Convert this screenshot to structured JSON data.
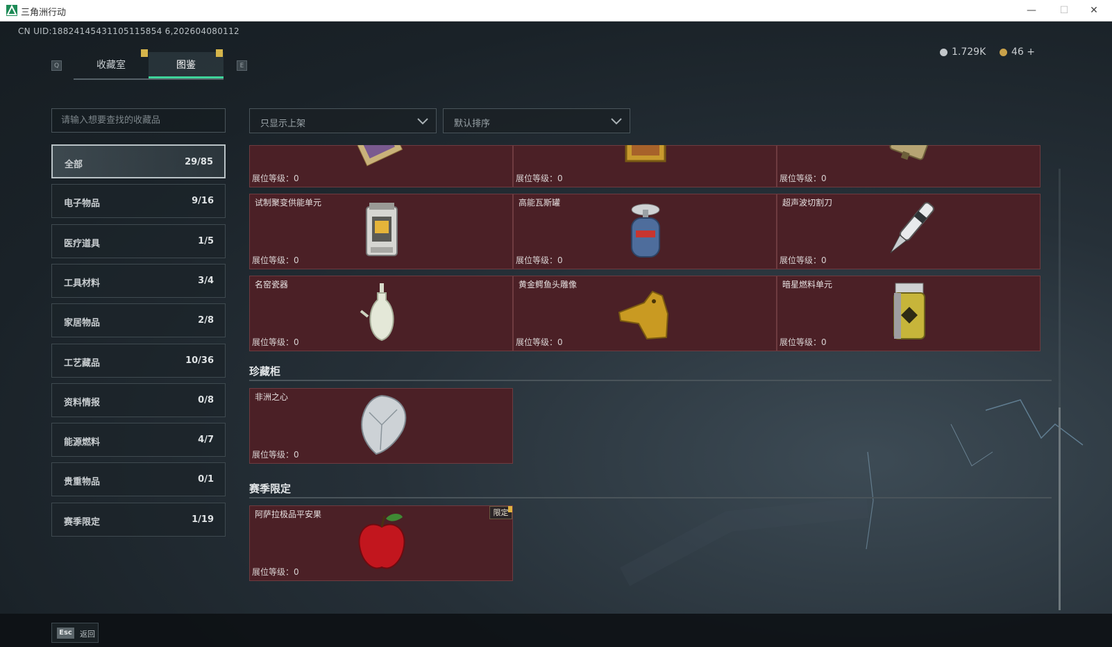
{
  "window": {
    "title": "三角洲行动",
    "minimize": "—",
    "maximize": "☐",
    "close": "✕"
  },
  "uid": "CN UID:18824145431105115854 6,202604080112",
  "tabs": {
    "key_left": "Q",
    "key_right": "E",
    "items": [
      {
        "label": "收藏室"
      },
      {
        "label": "图鉴"
      }
    ],
    "active": "图鉴"
  },
  "currency": [
    {
      "value": "1.729K",
      "color": "#c2c7ca"
    },
    {
      "value": "46 +",
      "color": "#c9a24a"
    }
  ],
  "search": {
    "placeholder": "请输入想要查找的收藏品"
  },
  "categories": [
    {
      "label": "全部",
      "count": "29/85",
      "active": true
    },
    {
      "label": "电子物品",
      "count": "9/16"
    },
    {
      "label": "医疗道具",
      "count": "1/5"
    },
    {
      "label": "工具材料",
      "count": "3/4"
    },
    {
      "label": "家居物品",
      "count": "2/8"
    },
    {
      "label": "工艺藏品",
      "count": "10/36"
    },
    {
      "label": "资料情报",
      "count": "0/8"
    },
    {
      "label": "能源燃料",
      "count": "4/7"
    },
    {
      "label": "贵重物品",
      "count": "0/1"
    },
    {
      "label": "赛季限定",
      "count": "1/19"
    }
  ],
  "filters": {
    "display": "只显示上架",
    "sort": "默认排序"
  },
  "level_label": "展位等级：",
  "rows": [
    [
      {
        "name": "",
        "level": "0",
        "icon": "card-artifact-icon"
      },
      {
        "name": "",
        "level": "0",
        "icon": "framed-painting-icon"
      },
      {
        "name": "",
        "level": "0",
        "icon": "circuit-device-icon"
      }
    ],
    [
      {
        "name": "试制聚变供能单元",
        "level": "0",
        "icon": "fusion-unit-icon"
      },
      {
        "name": "高能瓦斯罐",
        "level": "0",
        "icon": "gas-canister-icon"
      },
      {
        "name": "超声波切割刀",
        "level": "0",
        "icon": "ultrasonic-knife-icon"
      }
    ],
    [
      {
        "name": "名窑瓷器",
        "level": "0",
        "icon": "porcelain-vase-icon"
      },
      {
        "name": "黄金鳄鱼头雕像",
        "level": "0",
        "icon": "gold-crocodile-icon"
      },
      {
        "name": "暗星燃料单元",
        "level": "0",
        "icon": "fuel-cell-icon"
      }
    ]
  ],
  "sections": [
    {
      "title": "珍藏柜",
      "items": [
        {
          "name": "非洲之心",
          "level": "0",
          "icon": "diamond-icon"
        }
      ]
    },
    {
      "title": "赛季限定",
      "items": [
        {
          "name": "阿萨拉极品平安果",
          "level": "0",
          "icon": "apple-icon",
          "badge": "限定"
        }
      ]
    }
  ],
  "footer": {
    "esc_key": "Esc",
    "esc_label": "返回"
  },
  "colors": {
    "card_bg": "#4b2026",
    "accent": "#3fd49a",
    "gold": "#d6b54b"
  }
}
